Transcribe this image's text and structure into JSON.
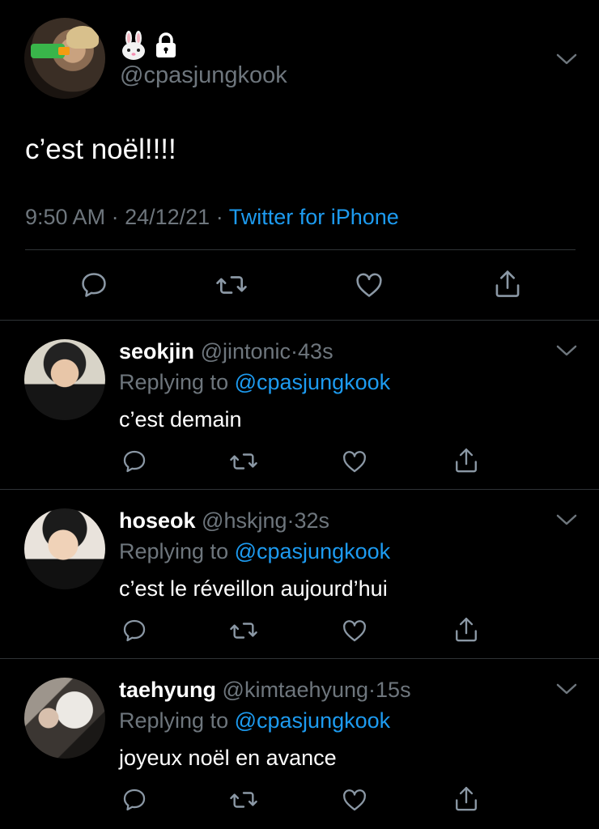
{
  "main_tweet": {
    "handle": "@cpasjungkook",
    "text": "c’est noël!!!!",
    "time": "9:50 AM",
    "date": "24/12/21",
    "separator": "·",
    "source": "Twitter for iPhone",
    "badges": [
      "rabbit-emoji",
      "lock-icon"
    ],
    "actions": [
      "reply-icon",
      "retweet-icon",
      "like-icon",
      "share-icon"
    ]
  },
  "replies": [
    {
      "name": "seokjin",
      "handle": "@jintonic",
      "separator": "·",
      "time": "43s",
      "replying_prefix": "Replying to",
      "replying_to": "@cpasjungkook",
      "text": "c’est demain"
    },
    {
      "name": "hoseok",
      "handle": "@hskjng",
      "separator": "·",
      "time": "32s",
      "replying_prefix": "Replying to",
      "replying_to": "@cpasjungkook",
      "text": "c’est le réveillon aujourd’hui"
    },
    {
      "name": "taehyung",
      "handle": "@kimtaehyung",
      "separator": "·",
      "time": "15s",
      "replying_prefix": "Replying to",
      "replying_to": "@cpasjungkook",
      "text": "joyeux noël en avance"
    }
  ],
  "colors": {
    "background": "#000000",
    "text": "#ffffff",
    "secondary": "#6e767d",
    "link": "#1d9bf0",
    "divider": "#2f3336"
  }
}
